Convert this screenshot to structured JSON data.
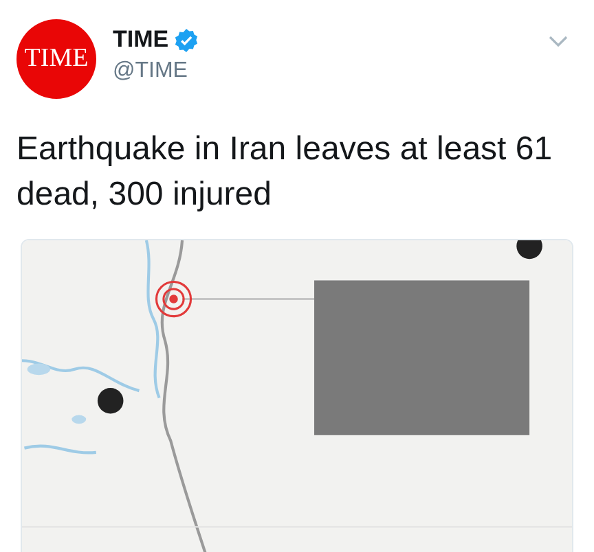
{
  "tweet": {
    "avatar_text": "TIME",
    "name": "TIME",
    "verified": true,
    "handle": "@TIME",
    "text": "Earthquake in Iran leaves at least 61 dead, 300 injured"
  }
}
